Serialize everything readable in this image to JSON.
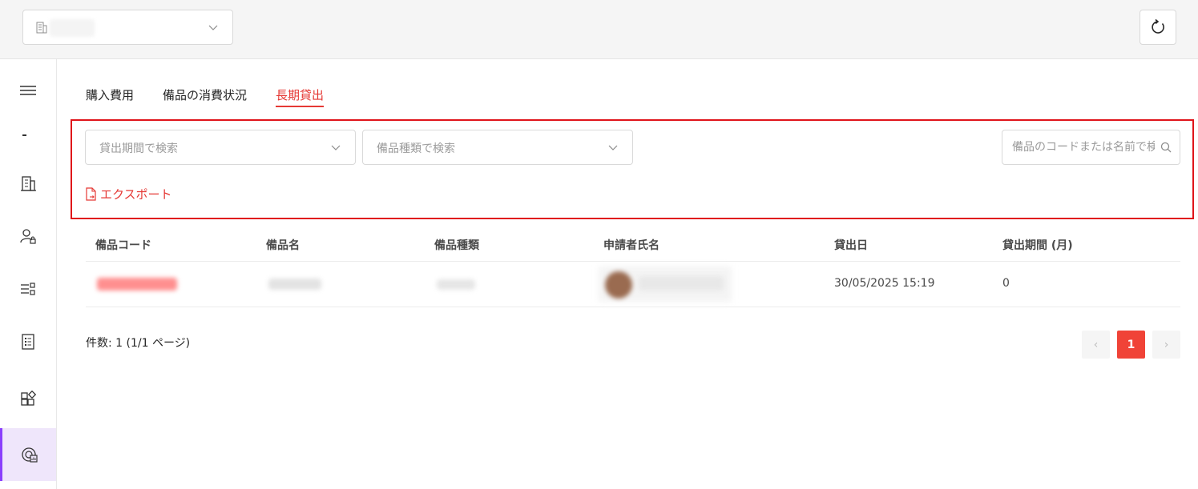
{
  "topbar": {
    "org_select": {
      "icon": "building-icon",
      "value": ""
    },
    "refresh_icon": "refresh-icon"
  },
  "sidebar": {
    "items": [
      {
        "icon": "menu-icon",
        "active": false
      },
      {
        "icon": "building-icon",
        "active": false
      },
      {
        "icon": "user-lock-icon",
        "active": false
      },
      {
        "icon": "settings-list-icon",
        "active": false
      },
      {
        "icon": "document-list-icon",
        "active": false
      },
      {
        "icon": "widgets-icon",
        "active": false
      },
      {
        "icon": "report-chart-icon",
        "active": true
      }
    ]
  },
  "tabs": [
    {
      "label": "購入費用",
      "active": false
    },
    {
      "label": "備品の消費状況",
      "active": false
    },
    {
      "label": "長期貸出",
      "active": true
    }
  ],
  "filters": {
    "loan_period": {
      "placeholder": "貸出期間で検索"
    },
    "item_type": {
      "placeholder": "備品種類で検索"
    },
    "search": {
      "placeholder": "備品のコードまたは名前で検索"
    },
    "export_label": "エクスポート"
  },
  "table": {
    "headers": [
      "備品コード",
      "備品名",
      "備品種類",
      "申請者氏名",
      "貸出日",
      "貸出期間 (月)"
    ],
    "rows": [
      {
        "code": "",
        "name": "",
        "type": "",
        "applicant": "",
        "loan_date": "30/05/2025 15:19",
        "loan_period": "0"
      }
    ]
  },
  "pagination": {
    "summary": "件数: 1 (1/1 ページ)",
    "prev": "‹",
    "current": "1",
    "next": "›"
  },
  "colors": {
    "accent": "#e53935",
    "sidebar_active": "#8a3ffc",
    "highlight_border": "#e0141a"
  }
}
